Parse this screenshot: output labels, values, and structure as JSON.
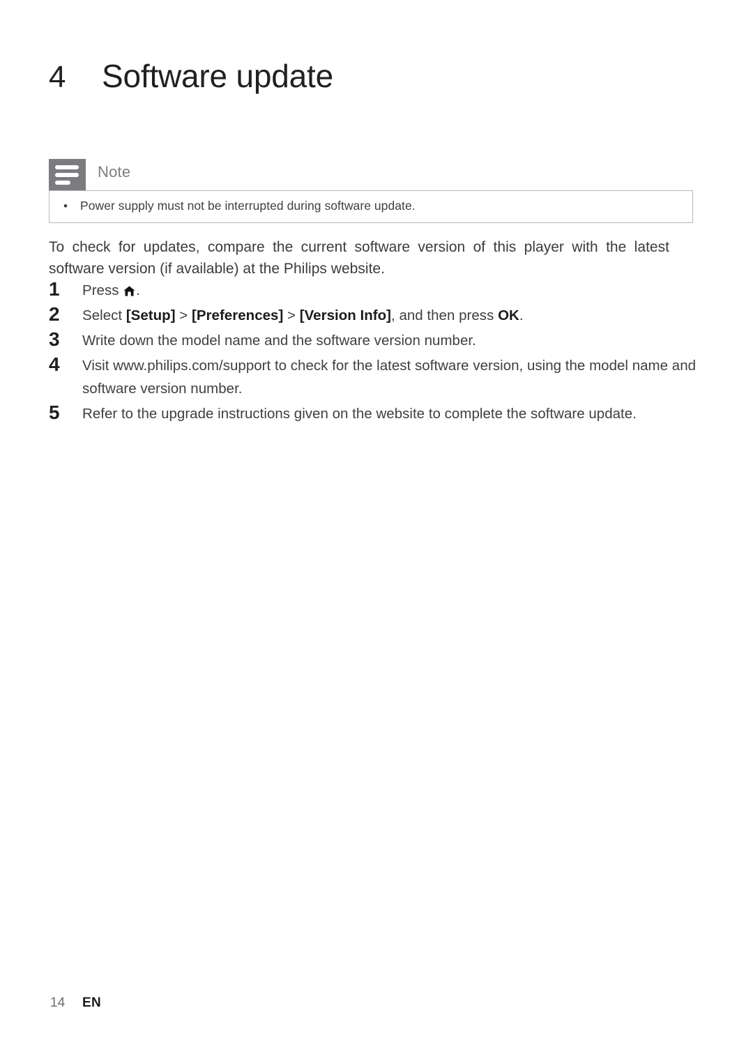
{
  "chapter": {
    "number": "4",
    "title": "Software update"
  },
  "note": {
    "icon": "note-lines-icon",
    "label": "Note",
    "bullet_char": "•",
    "items": [
      "Power supply must not be interrupted during software update."
    ]
  },
  "intro": "To check for updates, compare the current software version of this player with the latest software version (if available) at the Philips website.",
  "steps": [
    {
      "number": "1",
      "segments": [
        {
          "text": "Press ",
          "style": "normal"
        },
        {
          "text": "home-icon",
          "style": "icon"
        },
        {
          "text": ".",
          "style": "normal"
        }
      ],
      "plain": "Press ."
    },
    {
      "number": "2",
      "segments": [
        {
          "text": "Select ",
          "style": "normal"
        },
        {
          "text": "[Setup]",
          "style": "bold"
        },
        {
          "text": " > ",
          "style": "normal"
        },
        {
          "text": "[Preferences]",
          "style": "bold"
        },
        {
          "text": " > ",
          "style": "normal"
        },
        {
          "text": "[Version Info]",
          "style": "bold"
        },
        {
          "text": ", and then press ",
          "style": "normal"
        },
        {
          "text": "OK",
          "style": "bold"
        },
        {
          "text": ".",
          "style": "normal"
        }
      ],
      "plain": "Select [Setup] > [Preferences] > [Version Info], and then press OK."
    },
    {
      "number": "3",
      "segments": [
        {
          "text": "Write down the model name and the software version number.",
          "style": "normal"
        }
      ],
      "plain": "Write down the model name and the software version number."
    },
    {
      "number": "4",
      "segments": [
        {
          "text": "Visit www.philips.com/support to check for the latest software version, using the model name and software version number.",
          "style": "normal"
        }
      ],
      "plain": "Visit www.philips.com/support to check for the latest software version, using the model name and software version number."
    },
    {
      "number": "5",
      "segments": [
        {
          "text": "Refer to the upgrade instructions given on the website to complete the software update.",
          "style": "normal"
        }
      ],
      "plain": "Refer to the upgrade instructions given on the website to complete the software update."
    }
  ],
  "footer": {
    "page_number": "14",
    "language": "EN"
  },
  "colors": {
    "heading": "#231f20",
    "body": "#3b3b3d",
    "note_gray": "#7b7b80",
    "note_label": "#7d7d82",
    "border": "#b9b9bb",
    "page_bg": "#ffffff"
  }
}
